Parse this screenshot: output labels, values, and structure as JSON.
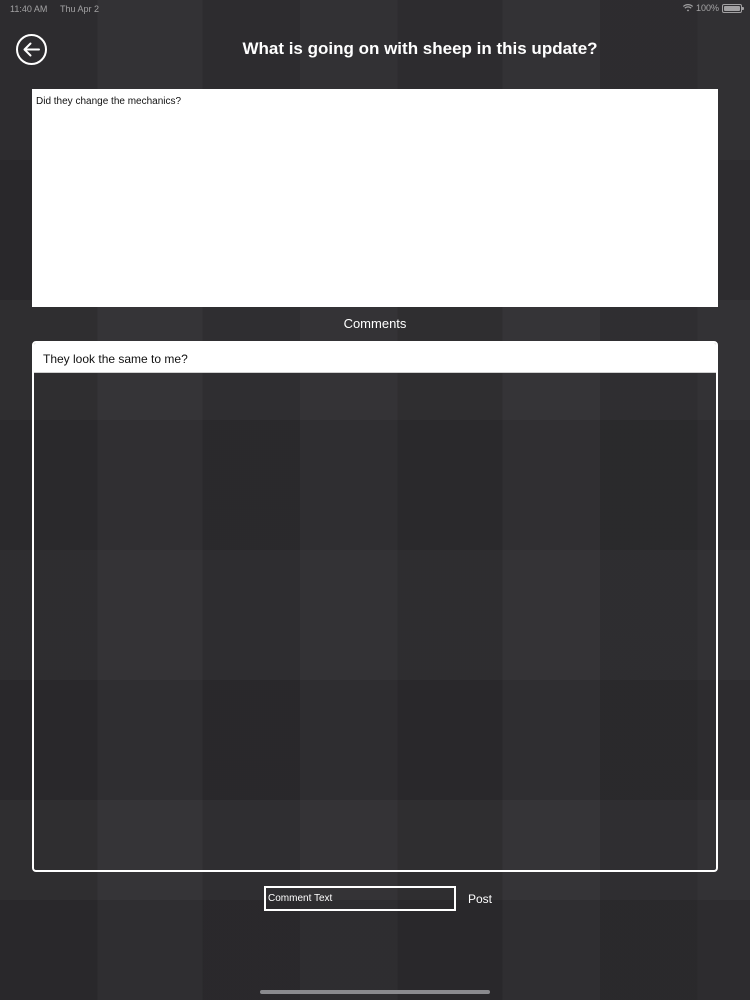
{
  "status_bar": {
    "time": "11:40 AM",
    "date": "Thu Apr 2",
    "battery": "100%"
  },
  "header": {
    "back_icon": "arrow-left-icon",
    "title": "What is going on with sheep in this update?"
  },
  "post": {
    "body": "Did they change the mechanics?"
  },
  "comments": {
    "label": "Comments",
    "items": [
      {
        "text": "They look the same to me?"
      }
    ]
  },
  "composer": {
    "placeholder": "Comment Text",
    "value": "",
    "post_label": "Post"
  },
  "colors": {
    "background": "#2d2c2f",
    "text": "#ffffff",
    "card": "#ffffff"
  }
}
